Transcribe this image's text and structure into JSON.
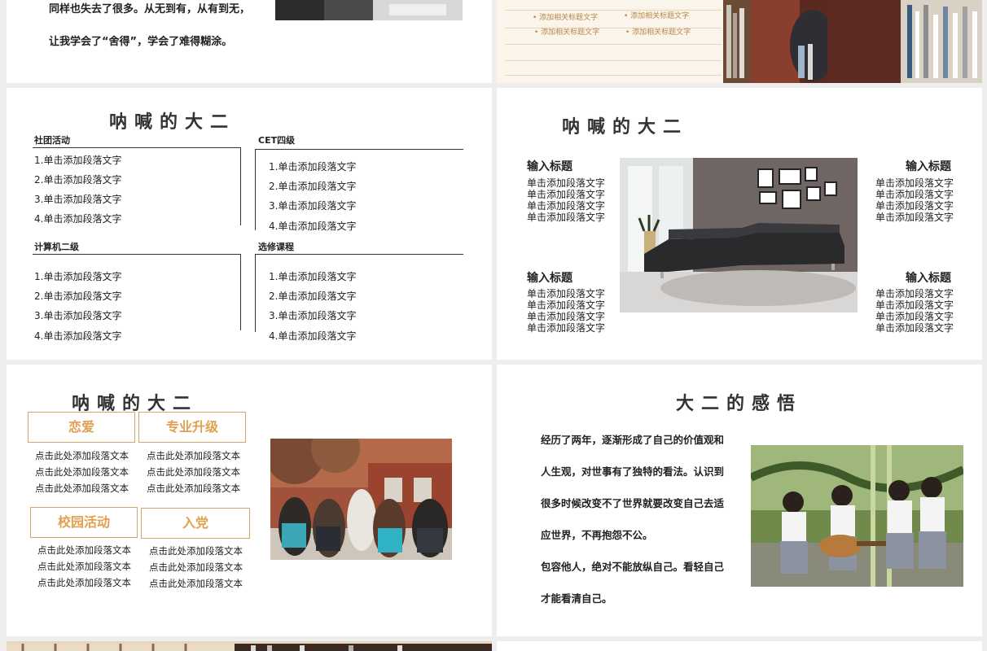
{
  "slide1": {
    "lines": [
      "同样也失去了很多。从无到有，从有到无，",
      "让我学会了“舍得”，学会了难得糊涂。"
    ]
  },
  "slide2": {
    "items": [
      "添加相关标题文字",
      "添加相关标题文字",
      "添加相关标题文字",
      "添加相关标题文字"
    ]
  },
  "slide3": {
    "title": "呐喊的大二",
    "sections": [
      {
        "label": "社团活动",
        "items": [
          "1.单击添加段落文字",
          "2.单击添加段落文字",
          "3.单击添加段落文字",
          "4.单击添加段落文字"
        ]
      },
      {
        "label": "CET四级",
        "items": [
          "1.单击添加段落文字",
          "2.单击添加段落文字",
          "3.单击添加段落文字",
          "4.单击添加段落文字"
        ]
      },
      {
        "label": "计算机二级",
        "items": [
          "1.单击添加段落文字",
          "2.单击添加段落文字",
          "3.单击添加段落文字",
          "4.单击添加段落文字"
        ]
      },
      {
        "label": "选修课程",
        "items": [
          "1.单击添加段落文字",
          "2.单击添加段落文字",
          "3.单击添加段落文字",
          "4.单击添加段落文字"
        ]
      }
    ]
  },
  "slide4": {
    "title": "呐喊的大二",
    "blocks": [
      {
        "heading": "输入标题",
        "lines": [
          "单击添加段落文字",
          "单击添加段落文字",
          "单击添加段落文字",
          "单击添加段落文字"
        ]
      },
      {
        "heading": "输入标题",
        "lines": [
          "单击添加段落文字",
          "单击添加段落文字",
          "单击添加段落文字",
          "单击添加段落文字"
        ]
      },
      {
        "heading": "输入标题",
        "lines": [
          "单击添加段落文字",
          "单击添加段落文字",
          "单击添加段落文字",
          "单击添加段落文字"
        ]
      },
      {
        "heading": "输入标题",
        "lines": [
          "单击添加段落文字",
          "单击添加段落文字",
          "单击添加段落文字",
          "单击添加段落文字"
        ]
      }
    ]
  },
  "slide5": {
    "title": "呐喊的大二",
    "boxes": [
      {
        "label": "恋爱",
        "lines": [
          "点击此处添加段落文本",
          "点击此处添加段落文本",
          "点击此处添加段落文本"
        ]
      },
      {
        "label": "专业升级",
        "lines": [
          "点击此处添加段落文本",
          "点击此处添加段落文本",
          "点击此处添加段落文本"
        ]
      },
      {
        "label": "校园活动",
        "lines": [
          "点击此处添加段落文本",
          "点击此处添加段落文本",
          "点击此处添加段落文本"
        ]
      },
      {
        "label": "入党",
        "lines": [
          "点击此处添加段落文本",
          "点击此处添加段落文本",
          "点击此处添加段落文本"
        ]
      }
    ]
  },
  "slide6": {
    "title": "大二的感悟",
    "lines": [
      "经历了两年，逐渐形成了自己的价值观和",
      "人生观，对世事有了独特的看法。认识到",
      "很多时候改变不了世界就要改变自己去适",
      "应世界，不再抱怨不公。",
      "包容他人，绝对不能放纵自己。看轻自己",
      "才能看清自己。"
    ]
  }
}
